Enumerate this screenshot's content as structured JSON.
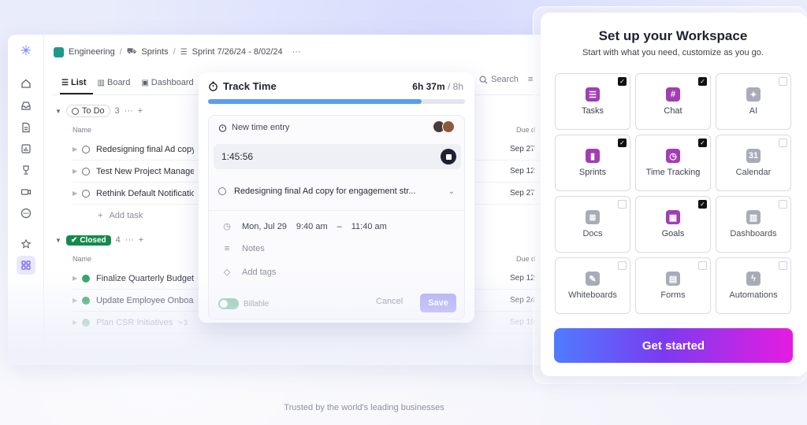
{
  "breadcrumb": {
    "space": "Engineering",
    "folder": "Sprints",
    "list": "Sprint 7/26/24 - 8/02/24",
    "more": "···"
  },
  "tabs": [
    {
      "label": "List"
    },
    {
      "label": "Board"
    },
    {
      "label": "Dashboard"
    }
  ],
  "search": {
    "label": "Search"
  },
  "groups": {
    "todo": {
      "label": "To Do",
      "count": "3",
      "more": "···",
      "add": "+",
      "col_name": "Name",
      "col_due": "Due d"
    },
    "closed": {
      "label": "Closed",
      "count": "4",
      "more": "···",
      "add": "+",
      "col_name": "Name",
      "col_due": "Due d"
    }
  },
  "todo_rows": [
    {
      "name": "Redesigning final Ad copy",
      "due": "Sep 27"
    },
    {
      "name": "Test New Project Manage",
      "due": "Sep 12"
    },
    {
      "name": "Rethink Default Notificatio",
      "due": "Sep 27"
    }
  ],
  "add_task": {
    "icon": "+",
    "label": "Add task"
  },
  "closed_rows": [
    {
      "name": "Finalize Quarterly Budget",
      "due": "Sep 12"
    },
    {
      "name": "Update Employee Onboar",
      "due": "Sep 24"
    },
    {
      "name": "Plan CSR Initiatives",
      "subcount": "3",
      "due": "Sep 19"
    }
  ],
  "track_time": {
    "title": "Track Time",
    "total": "6h 37m",
    "of": "/ 8h",
    "progress": 0.83,
    "new_entry": "New time entry",
    "timer": "1:45:56",
    "task": "Redesigning final Ad copy for engagement str...",
    "date": "Mon, Jul 29",
    "start": "9:40 am",
    "dash": "–",
    "end": "11:40 am",
    "notes": "Notes",
    "tags": "Add tags",
    "billable": "Billable",
    "cancel": "Cancel",
    "save": "Save"
  },
  "workspace": {
    "title": "Set up your Workspace",
    "subtitle": "Start with what you need, customize as you go.",
    "cards": [
      {
        "label": "Tasks",
        "checked": true,
        "icon": "tasks-icon"
      },
      {
        "label": "Chat",
        "checked": true,
        "icon": "chat-icon"
      },
      {
        "label": "AI",
        "checked": false,
        "icon": "ai-icon"
      },
      {
        "label": "Sprints",
        "checked": true,
        "icon": "sprints-icon"
      },
      {
        "label": "Time Tracking",
        "checked": true,
        "icon": "time-tracking-icon"
      },
      {
        "label": "Calendar",
        "checked": false,
        "icon": "calendar-icon"
      },
      {
        "label": "Docs",
        "checked": false,
        "icon": "docs-icon"
      },
      {
        "label": "Goals",
        "checked": true,
        "icon": "goals-icon"
      },
      {
        "label": "Dashboards",
        "checked": false,
        "icon": "dashboards-icon"
      },
      {
        "label": "Whiteboards",
        "checked": false,
        "icon": "whiteboards-icon"
      },
      {
        "label": "Forms",
        "checked": false,
        "icon": "forms-icon"
      },
      {
        "label": "Automations",
        "checked": false,
        "icon": "automations-icon"
      }
    ],
    "cta": "Get started"
  },
  "footer": {
    "trusted": "Trusted by the world's leading businesses"
  },
  "colors": {
    "accent_purple": "#a23db5",
    "closed_green": "#138a4a",
    "progress_blue": "#5b9cf0"
  }
}
